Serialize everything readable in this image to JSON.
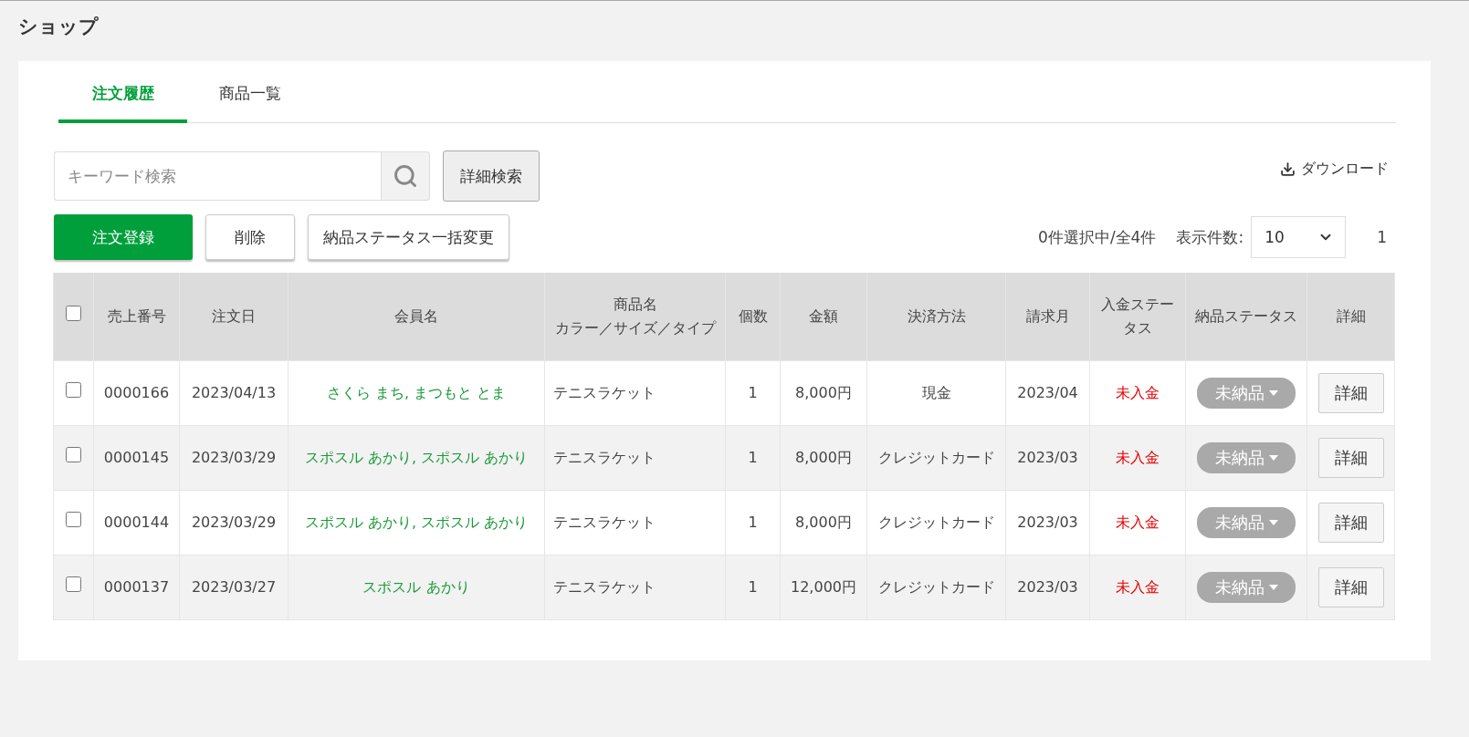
{
  "page_title": "ショップ",
  "tabs": [
    {
      "label": "注文履歴",
      "selected": true
    },
    {
      "label": "商品一覧",
      "selected": false
    }
  ],
  "search": {
    "placeholder": "キーワード検索"
  },
  "advanced_search_button": "詳細検索",
  "download_link": "ダウンロード",
  "actions": [
    {
      "label": "注文登録",
      "kind": "primary"
    },
    {
      "label": "削除",
      "kind": "default"
    },
    {
      "label": "納品ステータス一括変更",
      "kind": "default"
    }
  ],
  "selection_count": "0件選択中/全4件",
  "page_size": {
    "label": "表示件数:",
    "value": "10"
  },
  "page": "1",
  "table": {
    "select_all_checked": false,
    "columns": [
      [
        "売上番号"
      ],
      [
        "注文日"
      ],
      [
        "会員名"
      ],
      [
        "商品名",
        "カラー／サイズ／タイプ"
      ],
      [
        "個数"
      ],
      [
        "金額"
      ],
      [
        "決済方法"
      ],
      [
        "請求月"
      ],
      [
        "入金ステータス"
      ],
      [
        "納品ステータス"
      ],
      [
        "詳細"
      ]
    ],
    "rows": [
      {
        "checked": false,
        "sales_no": "0000166",
        "order_date": "2023/04/13",
        "member": "さくら まち, まつもと とま",
        "product": "テニスラケット",
        "quantity": "1",
        "amount": "8,000円",
        "payment": "現金",
        "billing_month": "2023/04",
        "payment_status": "未入金",
        "delivery_status": "未納品",
        "detail_button": "詳細"
      },
      {
        "checked": false,
        "sales_no": "0000145",
        "order_date": "2023/03/29",
        "member": "スポスル あかり, スポスル あかり",
        "product": "テニスラケット",
        "quantity": "1",
        "amount": "8,000円",
        "payment": "クレジットカード",
        "billing_month": "2023/03",
        "payment_status": "未入金",
        "delivery_status": "未納品",
        "detail_button": "詳細"
      },
      {
        "checked": false,
        "sales_no": "0000144",
        "order_date": "2023/03/29",
        "member": "スポスル あかり, スポスル あかり",
        "product": "テニスラケット",
        "quantity": "1",
        "amount": "8,000円",
        "payment": "クレジットカード",
        "billing_month": "2023/03",
        "payment_status": "未入金",
        "delivery_status": "未納品",
        "detail_button": "詳細"
      },
      {
        "checked": false,
        "sales_no": "0000137",
        "order_date": "2023/03/27",
        "member": "スポスル あかり",
        "product": "テニスラケット",
        "quantity": "1",
        "amount": "12,000円",
        "payment": "クレジットカード",
        "billing_month": "2023/03",
        "payment_status": "未入金",
        "delivery_status": "未納品",
        "detail_button": "詳細"
      }
    ]
  }
}
